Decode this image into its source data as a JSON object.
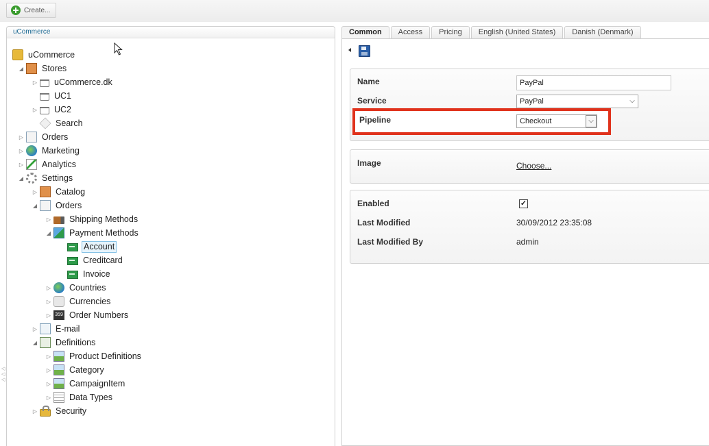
{
  "toolbar": {
    "create_label": "Create..."
  },
  "tree": {
    "header": "uCommerce",
    "nodes": [
      {
        "label": "uCommerce"
      },
      {
        "label": "Stores"
      },
      {
        "label": "uCommerce.dk"
      },
      {
        "label": "UC1"
      },
      {
        "label": "UC2"
      },
      {
        "label": "Search"
      },
      {
        "label": "Orders"
      },
      {
        "label": "Marketing"
      },
      {
        "label": "Analytics"
      },
      {
        "label": "Settings"
      },
      {
        "label": "Catalog"
      },
      {
        "label": "Orders"
      },
      {
        "label": "Shipping Methods"
      },
      {
        "label": "Payment Methods"
      },
      {
        "label": "Account"
      },
      {
        "label": "Creditcard"
      },
      {
        "label": "Invoice"
      },
      {
        "label": "Countries"
      },
      {
        "label": "Currencies"
      },
      {
        "label": "Order Numbers"
      },
      {
        "label": "E-mail"
      },
      {
        "label": "Definitions"
      },
      {
        "label": "Product Definitions"
      },
      {
        "label": "Category"
      },
      {
        "label": "CampaignItem"
      },
      {
        "label": "Data Types"
      },
      {
        "label": "Security"
      }
    ]
  },
  "tabs": [
    {
      "label": "Common"
    },
    {
      "label": "Access"
    },
    {
      "label": "Pricing"
    },
    {
      "label": "English (United States)"
    },
    {
      "label": "Danish (Denmark)"
    }
  ],
  "form": {
    "name_label": "Name",
    "name_value": "PayPal",
    "service_label": "Service",
    "service_value": "PayPal",
    "pipeline_label": "Pipeline",
    "pipeline_value": "Checkout",
    "image_label": "Image",
    "image_link": "Choose...",
    "enabled_label": "Enabled",
    "enabled_mark": "✓",
    "last_modified_label": "Last Modified",
    "last_modified_value": "30/09/2012 23:35:08",
    "last_modified_by_label": "Last Modified By",
    "last_modified_by_value": "admin"
  },
  "colors": {
    "highlight": "#e0321c",
    "link_header": "#1f6b94"
  }
}
